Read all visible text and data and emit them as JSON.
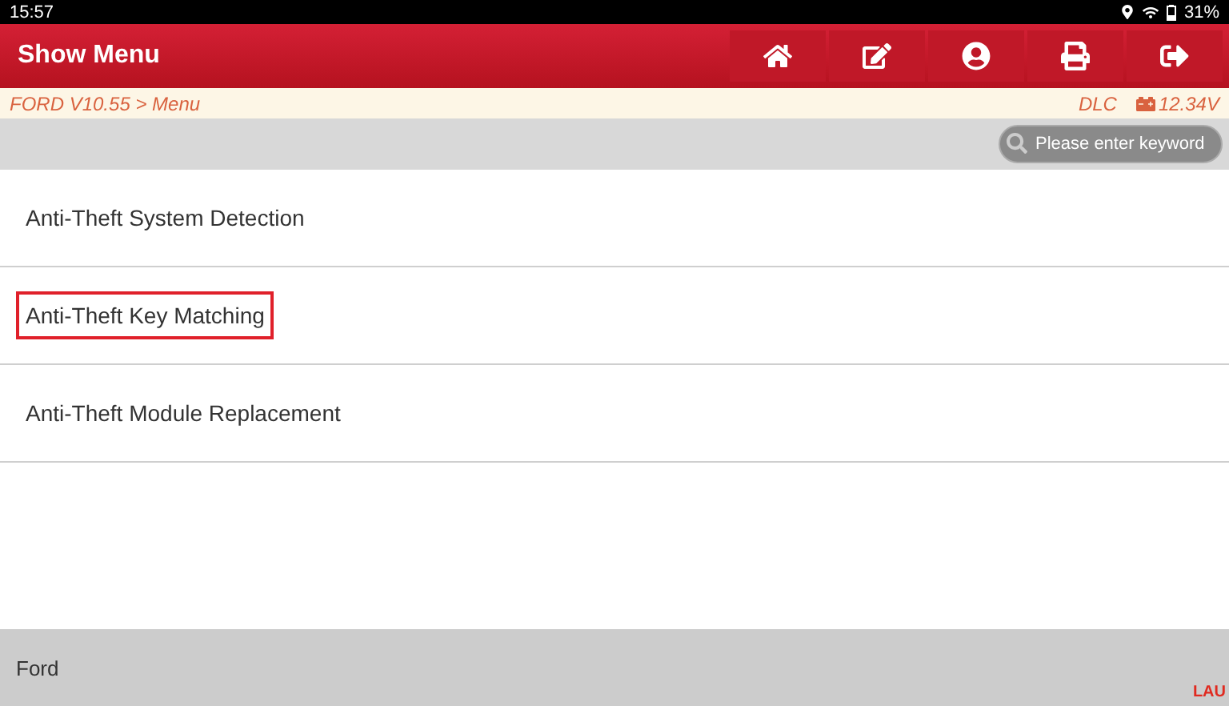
{
  "status_bar": {
    "time": "15:57",
    "battery": "31%"
  },
  "header": {
    "title": "Show Menu",
    "buttons": [
      {
        "kind": "home"
      },
      {
        "kind": "edit"
      },
      {
        "kind": "user"
      },
      {
        "kind": "print"
      },
      {
        "kind": "exit"
      }
    ]
  },
  "breadcrumb": {
    "path": "FORD V10.55 > Menu",
    "connector": "DLC",
    "voltage": "12.34V"
  },
  "search": {
    "placeholder": "Please enter keyword"
  },
  "menu": [
    {
      "label": "Anti-Theft System Detection",
      "selected": false
    },
    {
      "label": "Anti-Theft Key Matching",
      "selected": true
    },
    {
      "label": "Anti-Theft Module Replacement",
      "selected": false
    }
  ],
  "footer": {
    "text": "Ford",
    "logo": "LAU"
  }
}
